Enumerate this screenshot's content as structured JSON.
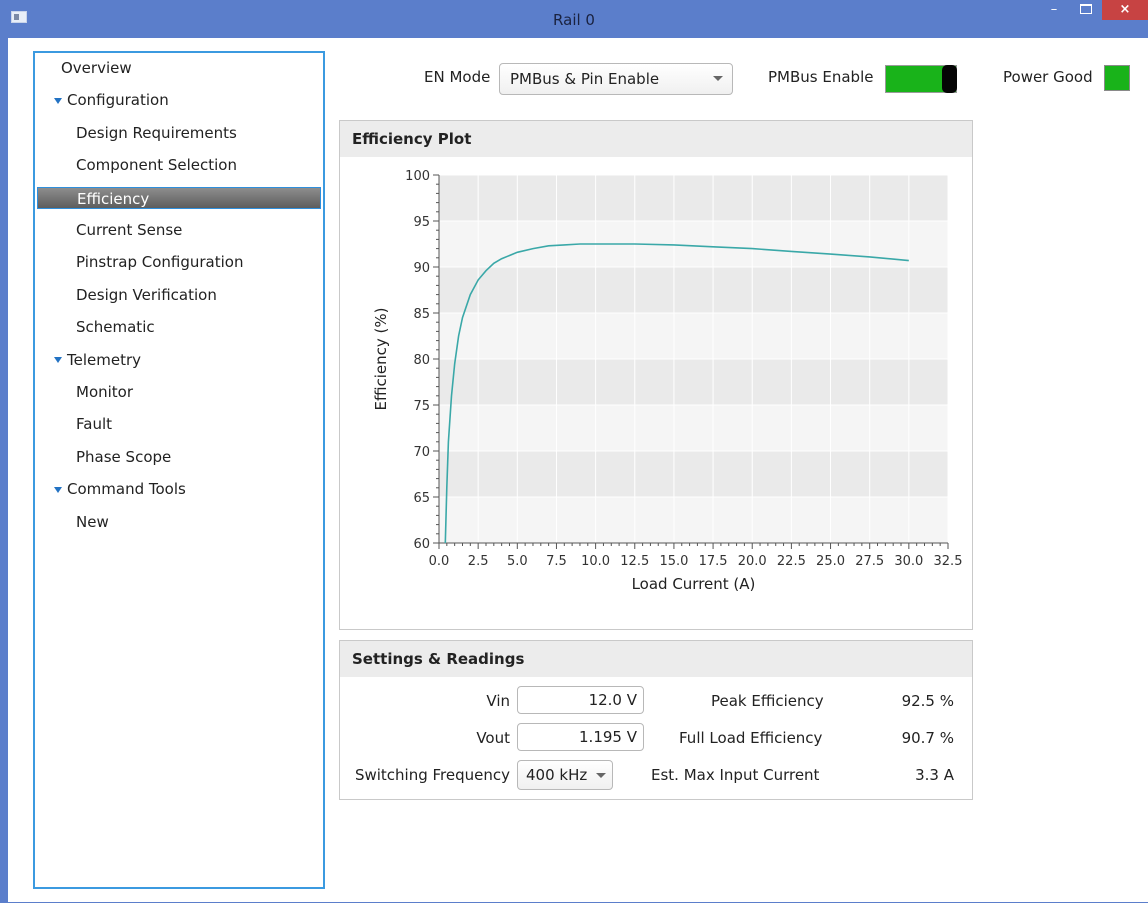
{
  "window": {
    "title": "Rail 0",
    "minimize": "–",
    "maximize": "",
    "close": "×"
  },
  "nav": {
    "items": [
      {
        "label": "Overview",
        "group": false
      },
      {
        "label": "Configuration",
        "group": true
      },
      {
        "label": "Design Requirements",
        "group": false
      },
      {
        "label": "Component Selection",
        "group": false
      },
      {
        "label": "Efficiency",
        "group": false,
        "selected": true
      },
      {
        "label": "Current Sense",
        "group": false
      },
      {
        "label": "Pinstrap Configuration",
        "group": false
      },
      {
        "label": "Design Verification",
        "group": false
      },
      {
        "label": "Schematic",
        "group": false
      },
      {
        "label": "Telemetry",
        "group": true
      },
      {
        "label": "Monitor",
        "group": false
      },
      {
        "label": "Fault",
        "group": false
      },
      {
        "label": "Phase Scope",
        "group": false
      },
      {
        "label": "Command Tools",
        "group": true
      },
      {
        "label": "New",
        "group": false
      }
    ]
  },
  "topbar": {
    "en_mode_label": "EN Mode",
    "en_mode_value": "PMBus & Pin Enable",
    "pmbus_enable_label": "PMBus Enable",
    "pmbus_enable_on": true,
    "power_good_label": "Power Good",
    "power_good_on": true
  },
  "plot_panel": {
    "title": "Efficiency Plot"
  },
  "chart_data": {
    "type": "line",
    "title": "",
    "xlabel": "Load Current (A)",
    "ylabel": "Efficiency (%)",
    "xlim": [
      0,
      32.5
    ],
    "ylim": [
      60,
      100
    ],
    "xticks": [
      "0.0",
      "2.5",
      "5.0",
      "7.5",
      "10.0",
      "12.5",
      "15.0",
      "17.5",
      "20.0",
      "22.5",
      "25.0",
      "27.5",
      "30.0",
      "32.5"
    ],
    "yticks": [
      "60",
      "65",
      "70",
      "75",
      "80",
      "85",
      "90",
      "95",
      "100"
    ],
    "grid": true,
    "line_color": "#3aa8a8",
    "series": [
      {
        "x": [
          0.4,
          0.5,
          0.6,
          0.8,
          1.0,
          1.25,
          1.5,
          2.0,
          2.5,
          3.0,
          3.5,
          4.0,
          5.0,
          6.0,
          7.0,
          8.0,
          9.0,
          10.0,
          12.5,
          15.0,
          17.5,
          20.0,
          22.5,
          25.0,
          27.5,
          30.0
        ],
        "y": [
          60.0,
          66.0,
          71.0,
          76.0,
          79.5,
          82.5,
          84.5,
          87.0,
          88.6,
          89.6,
          90.4,
          90.9,
          91.6,
          92.0,
          92.3,
          92.4,
          92.5,
          92.5,
          92.5,
          92.4,
          92.2,
          92.0,
          91.7,
          91.4,
          91.1,
          90.7
        ]
      }
    ]
  },
  "settings": {
    "title": "Settings & Readings",
    "vin_label": "Vin",
    "vin_value": "12.0 V",
    "vout_label": "Vout",
    "vout_value": "1.195 V",
    "fsw_label": "Switching Frequency",
    "fsw_value": "400 kHz",
    "peak_eff_label": "Peak Efficiency",
    "peak_eff_value": "92.5 %",
    "full_eff_label": "Full Load Efficiency",
    "full_eff_value": "90.7 %",
    "max_in_label": "Est. Max Input Current",
    "max_in_value": "3.3 A"
  }
}
